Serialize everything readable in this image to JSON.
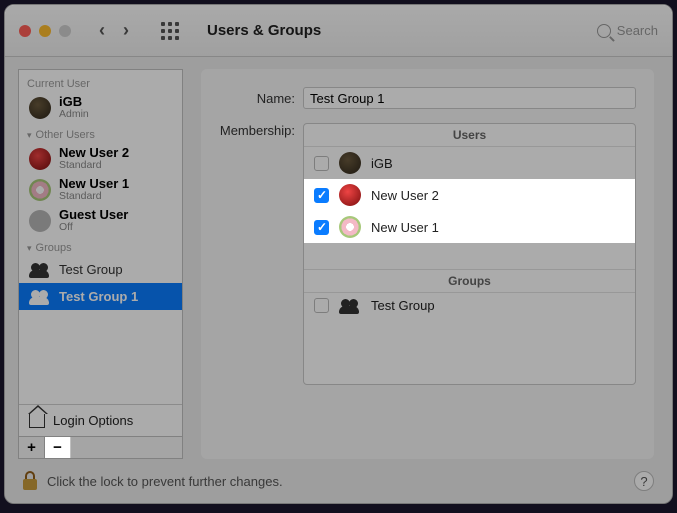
{
  "window": {
    "title": "Users & Groups",
    "search_placeholder": "Search"
  },
  "sidebar": {
    "sections": {
      "current": {
        "label": "Current User"
      },
      "other": {
        "label": "Other Users"
      },
      "groups": {
        "label": "Groups"
      }
    },
    "current_user": {
      "name": "iGB",
      "role": "Admin"
    },
    "other_users": [
      {
        "name": "New User 2",
        "role": "Standard"
      },
      {
        "name": "New User 1",
        "role": "Standard"
      },
      {
        "name": "Guest User",
        "role": "Off"
      }
    ],
    "groups": [
      {
        "name": "Test Group"
      },
      {
        "name": "Test Group 1",
        "selected": true
      }
    ],
    "login_options": "Login Options",
    "buttons": {
      "add": "+",
      "remove": "−"
    }
  },
  "main": {
    "labels": {
      "name": "Name:",
      "membership": "Membership:"
    },
    "name_value": "Test Group 1",
    "membership": {
      "headers": {
        "users": "Users",
        "groups": "Groups"
      },
      "users": [
        {
          "name": "iGB",
          "checked": false,
          "highlight": false
        },
        {
          "name": "New User 2",
          "checked": true,
          "highlight": true
        },
        {
          "name": "New User 1",
          "checked": true,
          "highlight": true
        }
      ],
      "groups": [
        {
          "name": "Test Group",
          "checked": false
        }
      ]
    }
  },
  "footer": {
    "lock_text": "Click the lock to prevent further changes.",
    "help": "?"
  }
}
